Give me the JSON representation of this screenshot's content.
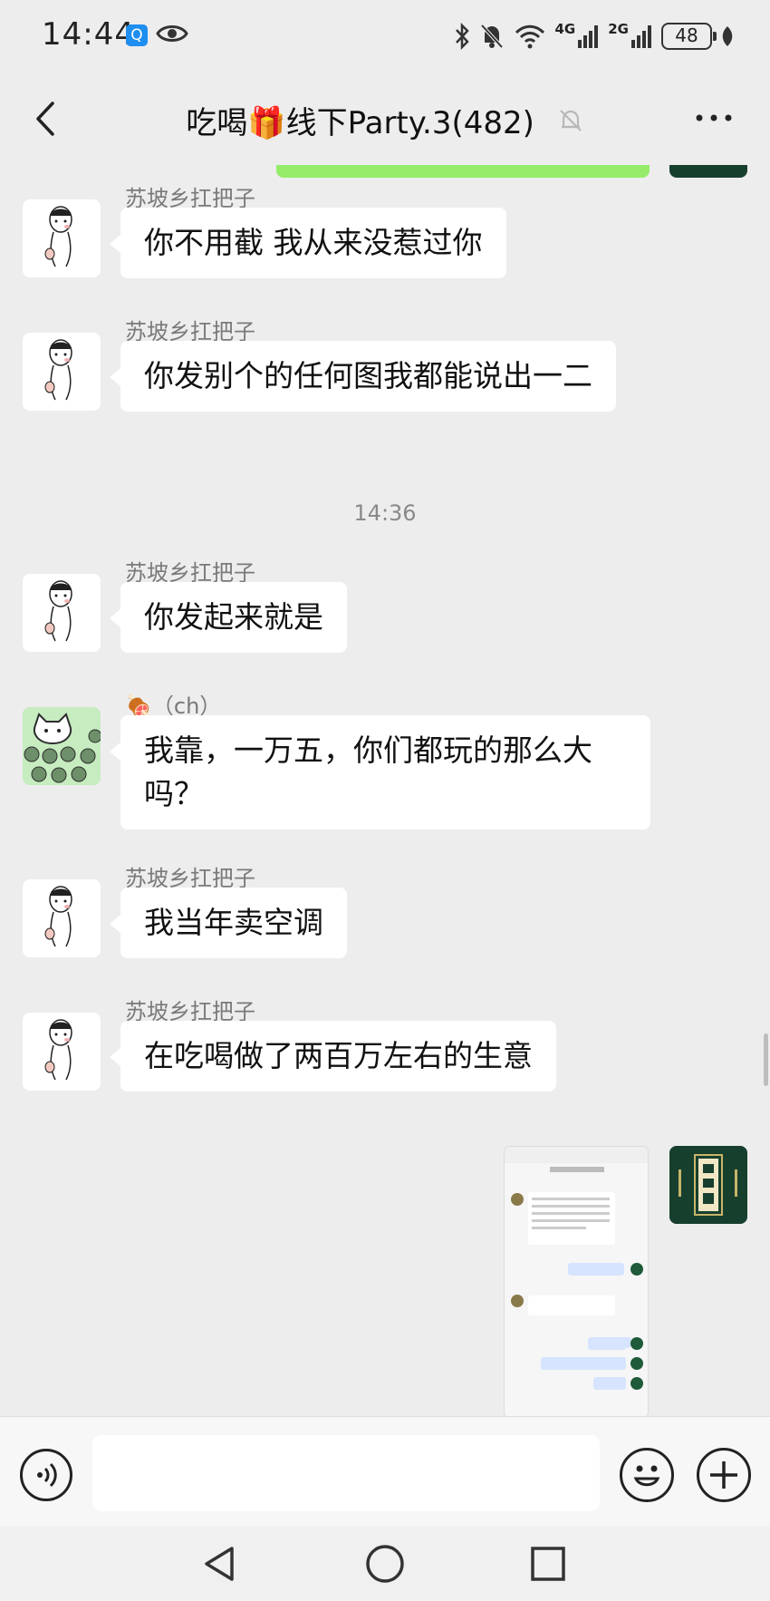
{
  "status_bar": {
    "time": "14:44",
    "app_badge": "Q",
    "net_4g": "4G",
    "net_2g": "2G",
    "battery": "48"
  },
  "header": {
    "title": "吃喝🎁线下Party.3(482)"
  },
  "messages": [
    {
      "sender": "苏坡乡扛把子",
      "text": "你不用截 我从来没惹过你"
    },
    {
      "sender": "苏坡乡扛把子",
      "text": "你发别个的任何图我都能说出一二"
    },
    {
      "timestamp": "14:36"
    },
    {
      "sender": "苏坡乡扛把子",
      "text": "你发起来就是"
    },
    {
      "sender": "🍖（ch）",
      "text": "我靠，一万五，你们都玩的那么大吗？"
    },
    {
      "sender": "苏坡乡扛把子",
      "text": "我当年卖空调"
    },
    {
      "sender": "苏坡乡扛把子",
      "text": "在吃喝做了两百万左右的生意"
    }
  ],
  "input": {
    "value": "",
    "placeholder": ""
  },
  "icons": {
    "back": "chevron-left-icon",
    "mute": "bell-off-icon",
    "more": "more-dots-icon",
    "voice": "voice-icon",
    "emoji": "emoji-icon",
    "plus": "plus-icon"
  },
  "colors": {
    "background": "#ededed",
    "bubble_self": "#95ec69",
    "bubble_other": "#ffffff",
    "sender_name": "#7a7a7a"
  }
}
